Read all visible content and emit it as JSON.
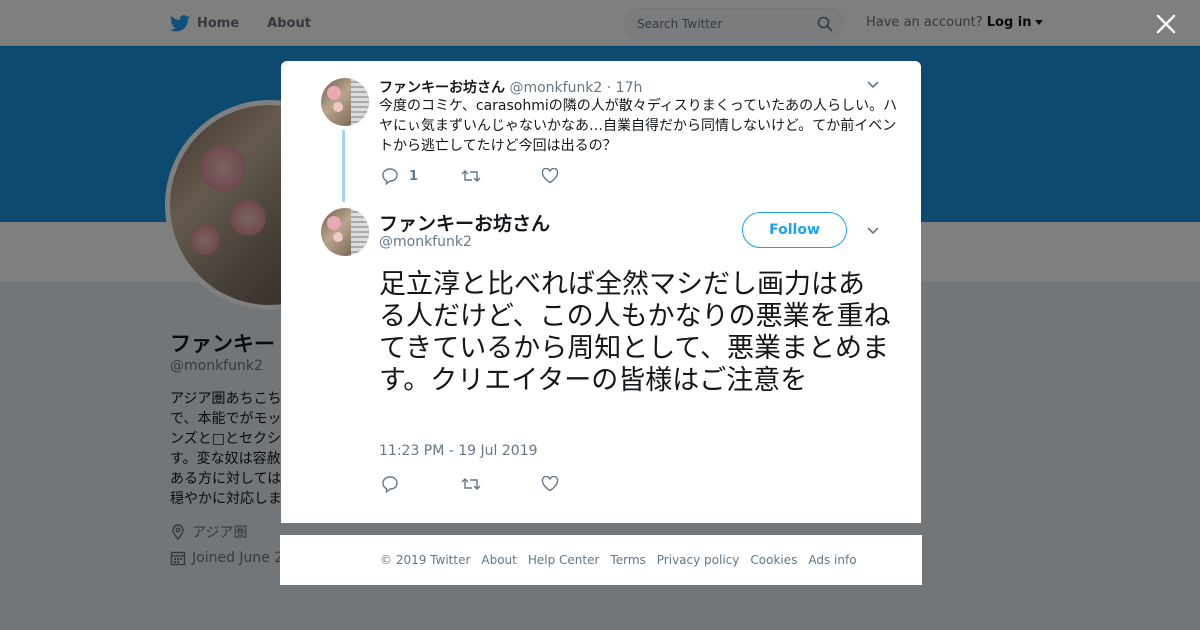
{
  "nav": {
    "home_label": "Home",
    "about_label": "About",
    "search_placeholder": "Search Twitter",
    "have_account": "Have an account?",
    "login_label": "Log in"
  },
  "profile": {
    "name": "ファンキー",
    "handle": "@monkfunk2",
    "bio": "アジア圏あちこちで、本能でがモッンズと□とセクシす。変な奴は容赦ある方に対しては穏やかに対応しま",
    "location": "アジア圏",
    "joined": "Joined June 2"
  },
  "tweet1": {
    "name": "ファンキーお坊さん",
    "handle": "@monkfunk2",
    "time": "· 17h",
    "text": "今度のコミケ、carasohmiの隣の人が散々ディスりまくっていたあの人らしい。ハヤにぃ気まずいんじゃないかなあ…自業自得だから同情しないけど。てか前イベントから逃亡してたけど今回は出るの？",
    "reply_count": "1"
  },
  "tweet2": {
    "name": "ファンキーお坊さん",
    "handle": "@monkfunk2",
    "follow_label": "Follow",
    "text": "足立淳と比べれば全然マシだし画力はある人だけど、この人もかなりの悪業を重ねてきているから周知として、悪業まとめます。クリエイターの皆様はご注意を",
    "timestamp": "11:23 PM - 19 Jul 2019"
  },
  "footer": {
    "links": [
      "© 2019 Twitter",
      "About",
      "Help Center",
      "Terms",
      "Privacy policy",
      "Cookies",
      "Ads info"
    ]
  },
  "colors": {
    "brand": "#1da1f2",
    "banner": "#1b95e0",
    "thread_line": "#a5d4f0"
  },
  "icons": [
    "twitter-bird-icon",
    "search-icon",
    "close-icon",
    "chevron-down-icon",
    "reply-icon",
    "retweet-icon",
    "heart-icon",
    "location-icon",
    "calendar-icon"
  ]
}
